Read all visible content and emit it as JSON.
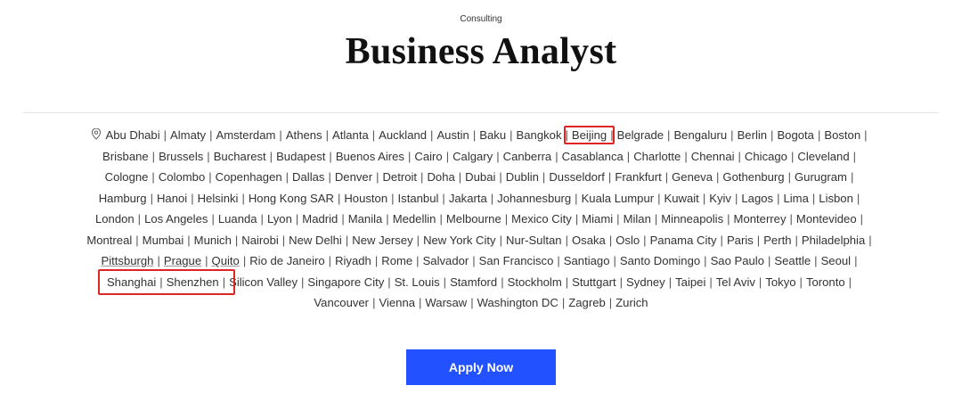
{
  "header": {
    "category": "Consulting",
    "title": "Business Analyst"
  },
  "locations": {
    "icon": "location-pin-icon",
    "separator": "|",
    "lines": [
      [
        "Abu Dhabi",
        "Almaty",
        "Amsterdam",
        "Athens",
        "Atlanta",
        "Auckland",
        "Austin",
        "Baku",
        "Bangkok",
        "Beijing",
        "Belgrade",
        "Bengaluru",
        "Berlin",
        "Bogota",
        "Boston"
      ],
      [
        "Brisbane",
        "Brussels",
        "Bucharest",
        "Budapest",
        "Buenos Aires",
        "Cairo",
        "Calgary",
        "Canberra",
        "Casablanca",
        "Charlotte",
        "Chennai",
        "Chicago",
        "Cleveland"
      ],
      [
        "Cologne",
        "Colombo",
        "Copenhagen",
        "Dallas",
        "Denver",
        "Detroit",
        "Doha",
        "Dubai",
        "Dublin",
        "Dusseldorf",
        "Frankfurt",
        "Geneva",
        "Gothenburg",
        "Gurugram"
      ],
      [
        "Hamburg",
        "Hanoi",
        "Helsinki",
        "Hong Kong SAR",
        "Houston",
        "Istanbul",
        "Jakarta",
        "Johannesburg",
        "Kuala Lumpur",
        "Kuwait",
        "Kyiv",
        "Lagos",
        "Lima",
        "Lisbon"
      ],
      [
        "London",
        "Los Angeles",
        "Luanda",
        "Lyon",
        "Madrid",
        "Manila",
        "Medellin",
        "Melbourne",
        "Mexico City",
        "Miami",
        "Milan",
        "Minneapolis",
        "Monterrey",
        "Montevideo"
      ],
      [
        "Montreal",
        "Mumbai",
        "Munich",
        "Nairobi",
        "New Delhi",
        "New Jersey",
        "New York City",
        "Nur-Sultan",
        "Osaka",
        "Oslo",
        "Panama City",
        "Paris",
        "Perth",
        "Philadelphia"
      ],
      [
        "Pittsburgh",
        "Prague",
        "Quito",
        "Rio de Janeiro",
        "Riyadh",
        "Rome",
        "Salvador",
        "San Francisco",
        "Santiago",
        "Santo Domingo",
        "Sao Paulo",
        "Seattle",
        "Seoul"
      ],
      [
        "Shanghai",
        "Shenzhen",
        "Silicon Valley",
        "Singapore City",
        "St. Louis",
        "Stamford",
        "Stockholm",
        "Stuttgart",
        "Sydney",
        "Taipei",
        "Tel Aviv",
        "Tokyo",
        "Toronto"
      ],
      [
        "Vancouver",
        "Vienna",
        "Warsaw",
        "Washington DC",
        "Zagreb",
        "Zurich"
      ]
    ],
    "underlined": [
      "Pittsburgh",
      "Prague",
      "Quito"
    ],
    "highlighted": [
      "Beijing",
      "Shanghai",
      "Shenzhen"
    ],
    "highlight_color": "#e02424"
  },
  "apply_button": {
    "label": "Apply Now",
    "color": "#2251ff"
  }
}
